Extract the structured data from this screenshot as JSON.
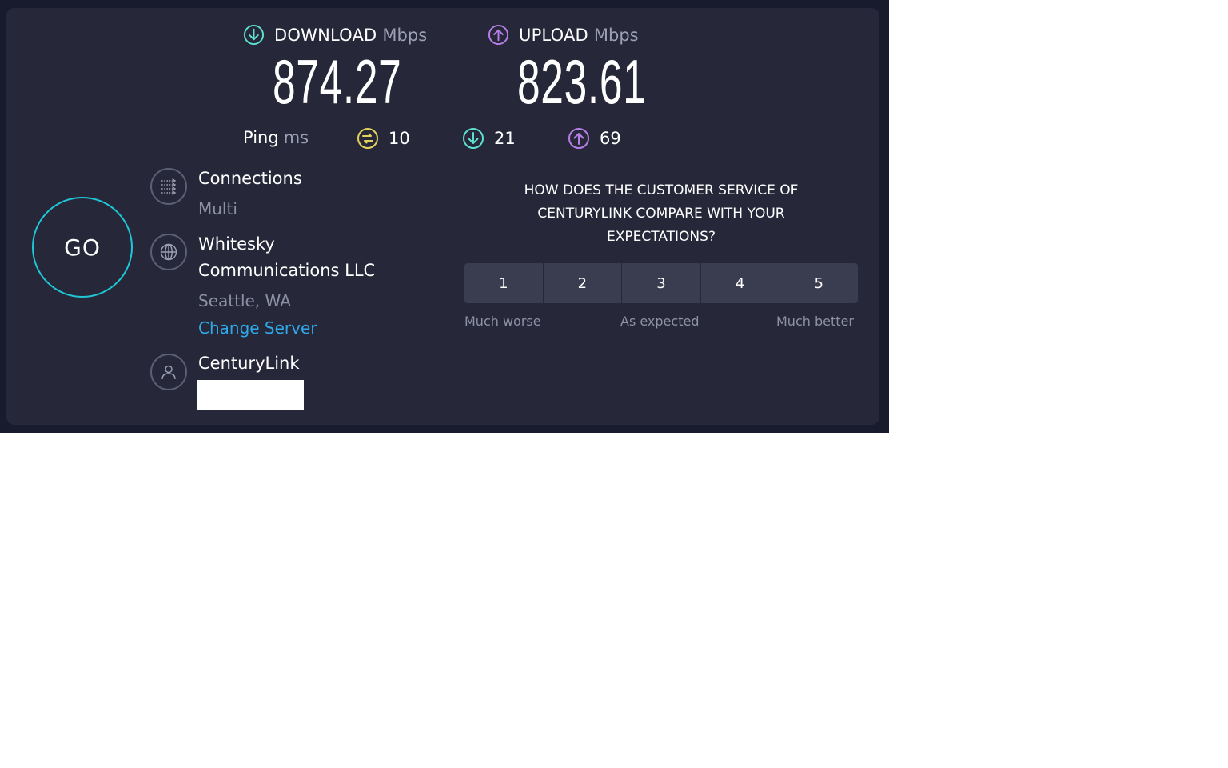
{
  "download": {
    "label": "DOWNLOAD",
    "unit": "Mbps",
    "value": "874.27",
    "icon": "download-arrow-icon",
    "color": "#5de0d0"
  },
  "upload": {
    "label": "UPLOAD",
    "unit": "Mbps",
    "value": "823.61",
    "icon": "upload-arrow-icon",
    "color": "#b77ee8"
  },
  "ping": {
    "label": "Ping",
    "unit": "ms",
    "idle": {
      "value": "10",
      "icon": "ping-idle-icon",
      "color": "#e4d35a"
    },
    "download": {
      "value": "21",
      "icon": "download-arrow-icon",
      "color": "#5de0d0"
    },
    "upload": {
      "value": "69",
      "icon": "upload-arrow-icon",
      "color": "#b77ee8"
    }
  },
  "go_button": {
    "label": "GO",
    "color": "#1fc7d6"
  },
  "connections": {
    "title": "Connections",
    "value": "Multi",
    "icon": "connections-icon"
  },
  "server": {
    "title_line1": "Whitesky",
    "title_line2": "Communications LLC",
    "location": "Seattle, WA",
    "change_link": "Change Server",
    "icon": "globe-icon"
  },
  "provider": {
    "name": "CenturyLink",
    "icon": "user-icon"
  },
  "survey": {
    "question_line1": "HOW DOES THE CUSTOMER SERVICE OF",
    "question_line2": "CENTURYLINK COMPARE WITH YOUR",
    "question_line3": "EXPECTATIONS?",
    "options": [
      "1",
      "2",
      "3",
      "4",
      "5"
    ],
    "low_label": "Much worse",
    "mid_label": "As expected",
    "high_label": "Much better"
  }
}
